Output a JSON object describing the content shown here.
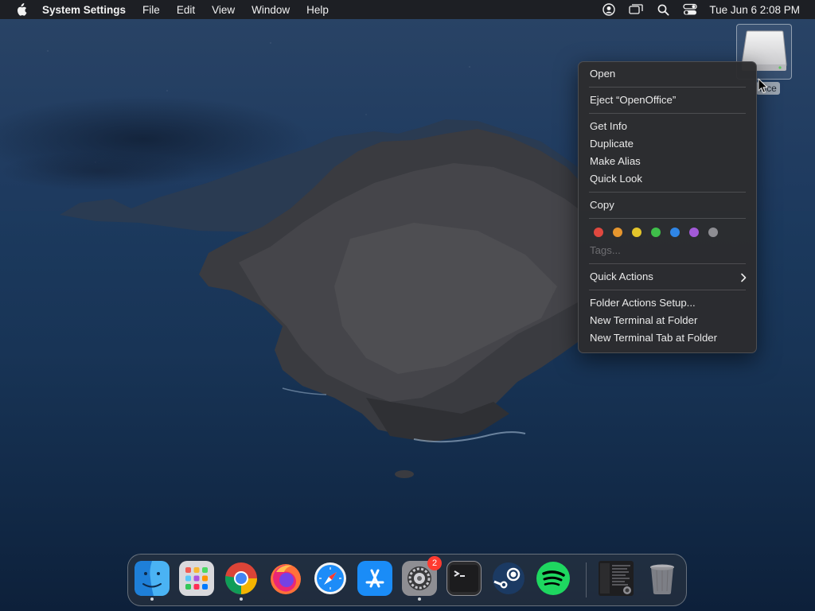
{
  "menubar": {
    "app_name": "System Settings",
    "items": [
      "File",
      "Edit",
      "View",
      "Window",
      "Help"
    ],
    "clock": "Tue Jun 6  2:08 PM"
  },
  "desktop": {
    "drive_label": "ffice"
  },
  "context_menu": {
    "items": {
      "open": "Open",
      "eject": "Eject “OpenOffice”",
      "get_info": "Get Info",
      "duplicate": "Duplicate",
      "make_alias": "Make Alias",
      "quick_look": "Quick Look",
      "copy": "Copy",
      "tags": "Tags...",
      "quick_actions": "Quick Actions",
      "folder_actions": "Folder Actions Setup...",
      "new_terminal": "New Terminal at Folder",
      "new_terminal_tab": "New Terminal Tab at Folder"
    },
    "tag_colors": [
      "#e0483f",
      "#e6962e",
      "#e4c52b",
      "#3fbf4a",
      "#2f86e6",
      "#a35ad8",
      "#8e8e93"
    ]
  },
  "dock": {
    "apps": [
      "finder",
      "launchpad",
      "chrome",
      "firefox",
      "safari",
      "app-store",
      "system-settings",
      "terminal",
      "steam",
      "spotify",
      "recent-window",
      "trash"
    ],
    "settings_badge": "2"
  }
}
